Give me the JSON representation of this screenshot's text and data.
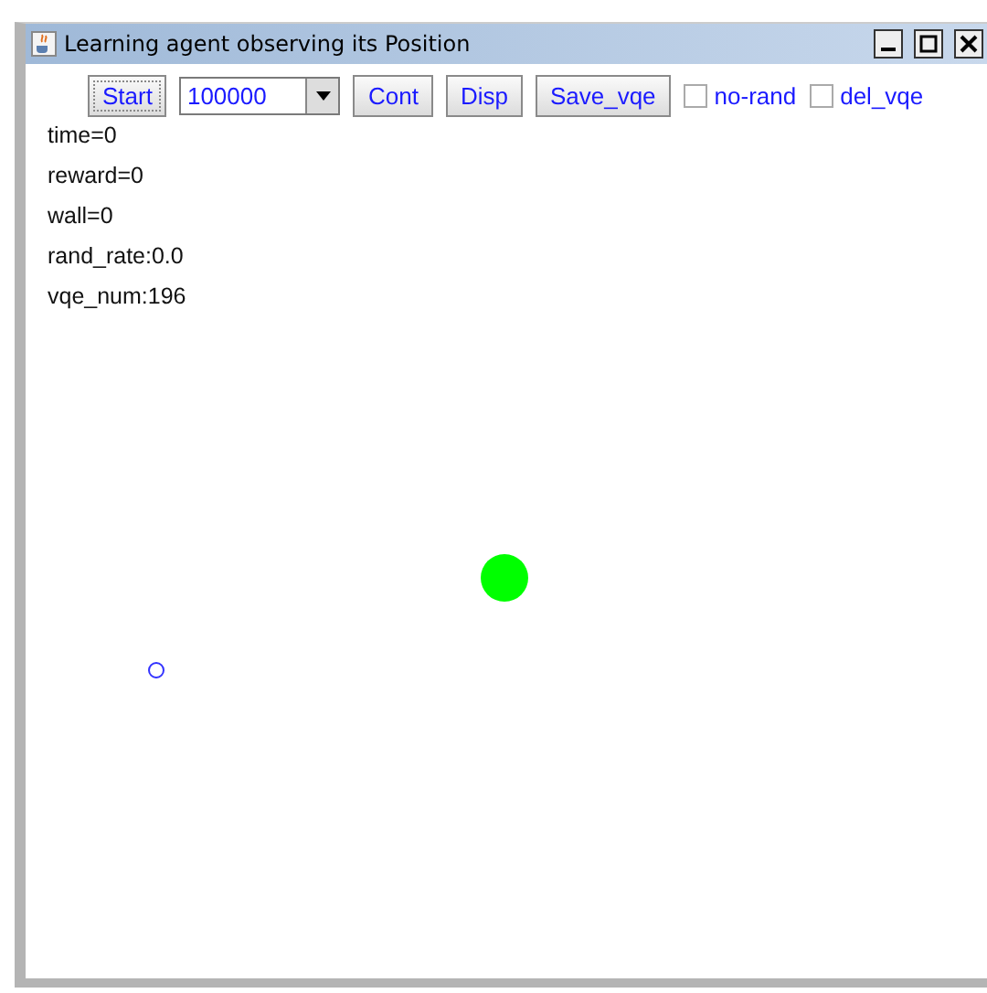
{
  "window": {
    "title": "Learning agent observing its Position"
  },
  "toolbar": {
    "buttons": [
      {
        "label": "Start",
        "focused": true
      }
    ],
    "episodes": {
      "value": "100000"
    },
    "more_buttons": [
      {
        "label": "Cont"
      },
      {
        "label": "Disp"
      },
      {
        "label": "Save_vqe"
      }
    ],
    "checkboxes": [
      {
        "label": "no-rand",
        "checked": false
      },
      {
        "label": "del_vqe",
        "checked": false
      }
    ]
  },
  "status": [
    "time=0",
    "reward=0",
    "wall=0",
    "rand_rate:0.0",
    "vqe_num:196"
  ],
  "canvas": {
    "items": [
      {
        "kind": "goal",
        "color": "#00ff00"
      },
      {
        "kind": "agent",
        "color": "#3333ff"
      }
    ]
  }
}
